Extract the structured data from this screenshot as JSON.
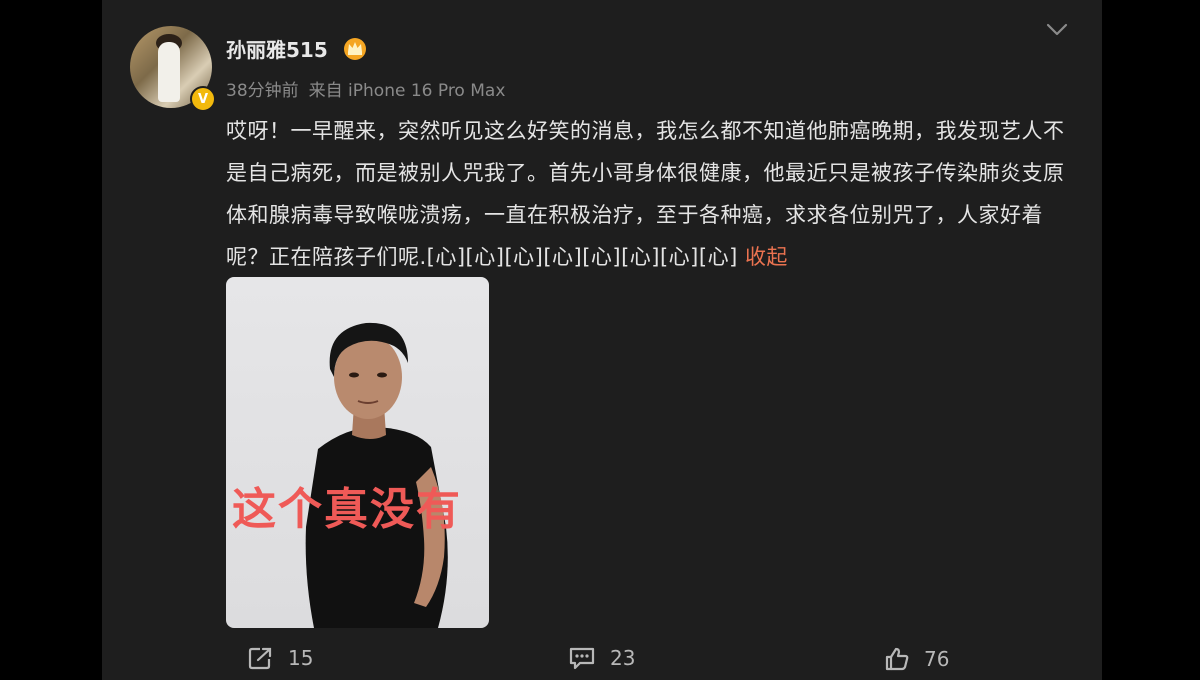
{
  "post": {
    "author": "孙丽雅515",
    "time": "38分钟前",
    "source": "来自 iPhone 16 Pro Max",
    "text": "哎呀！一早醒来，突然听见这么好笑的消息，我怎么都不知道他肺癌晚期，我发现艺人不是自己病死，而是被别人咒我了。首先小哥身体很健康，他最近只是被孩子传染肺炎支原体和腺病毒导致喉咙溃疡，一直在积极治疗，至于各种癌，求求各位别咒了，人家好着呢？正在陪孩子们呢.[心][心][心][心][心][心][心][心] ",
    "collapse_label": "收起",
    "image_caption": "这个真没有",
    "verified_badge": "V"
  },
  "actions": {
    "share_count": "15",
    "comment_count": "23",
    "like_count": "76"
  },
  "icons": {
    "crown": "crown-icon",
    "more": "chevron-down-icon",
    "share": "share-icon",
    "comment": "comment-icon",
    "like": "thumbs-up-icon"
  },
  "colors": {
    "background": "#000000",
    "card": "#1e1e1e",
    "text": "#e4e4e4",
    "muted": "#8a8a8a",
    "accent": "#eb7350",
    "caption": "#ef5a57",
    "badge": "#f2b90d"
  }
}
